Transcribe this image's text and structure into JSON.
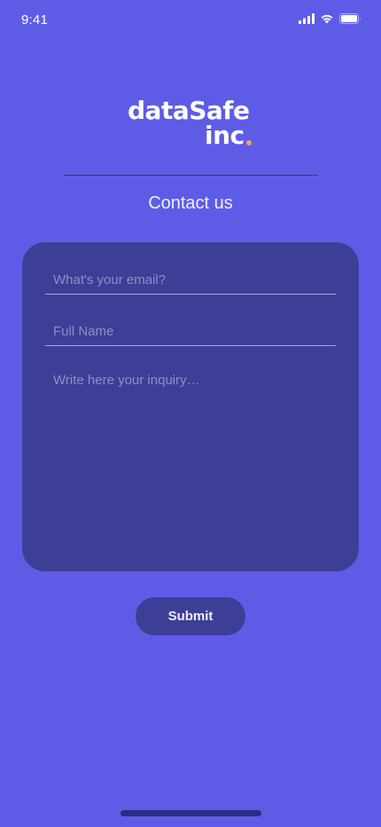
{
  "status_bar": {
    "time": "9:41"
  },
  "logo": {
    "line1": "dataSafe",
    "line2": "inc",
    "dot_color": "#f5a15a"
  },
  "page": {
    "title": "Contact us"
  },
  "form": {
    "email_placeholder": "What's your email?",
    "name_placeholder": "Full Name",
    "inquiry_placeholder": "Write here your inquiry…"
  },
  "actions": {
    "submit_label": "Submit"
  },
  "colors": {
    "background": "#5e5ce6",
    "card": "#3f3e96",
    "accent_dot": "#f5a15a"
  }
}
